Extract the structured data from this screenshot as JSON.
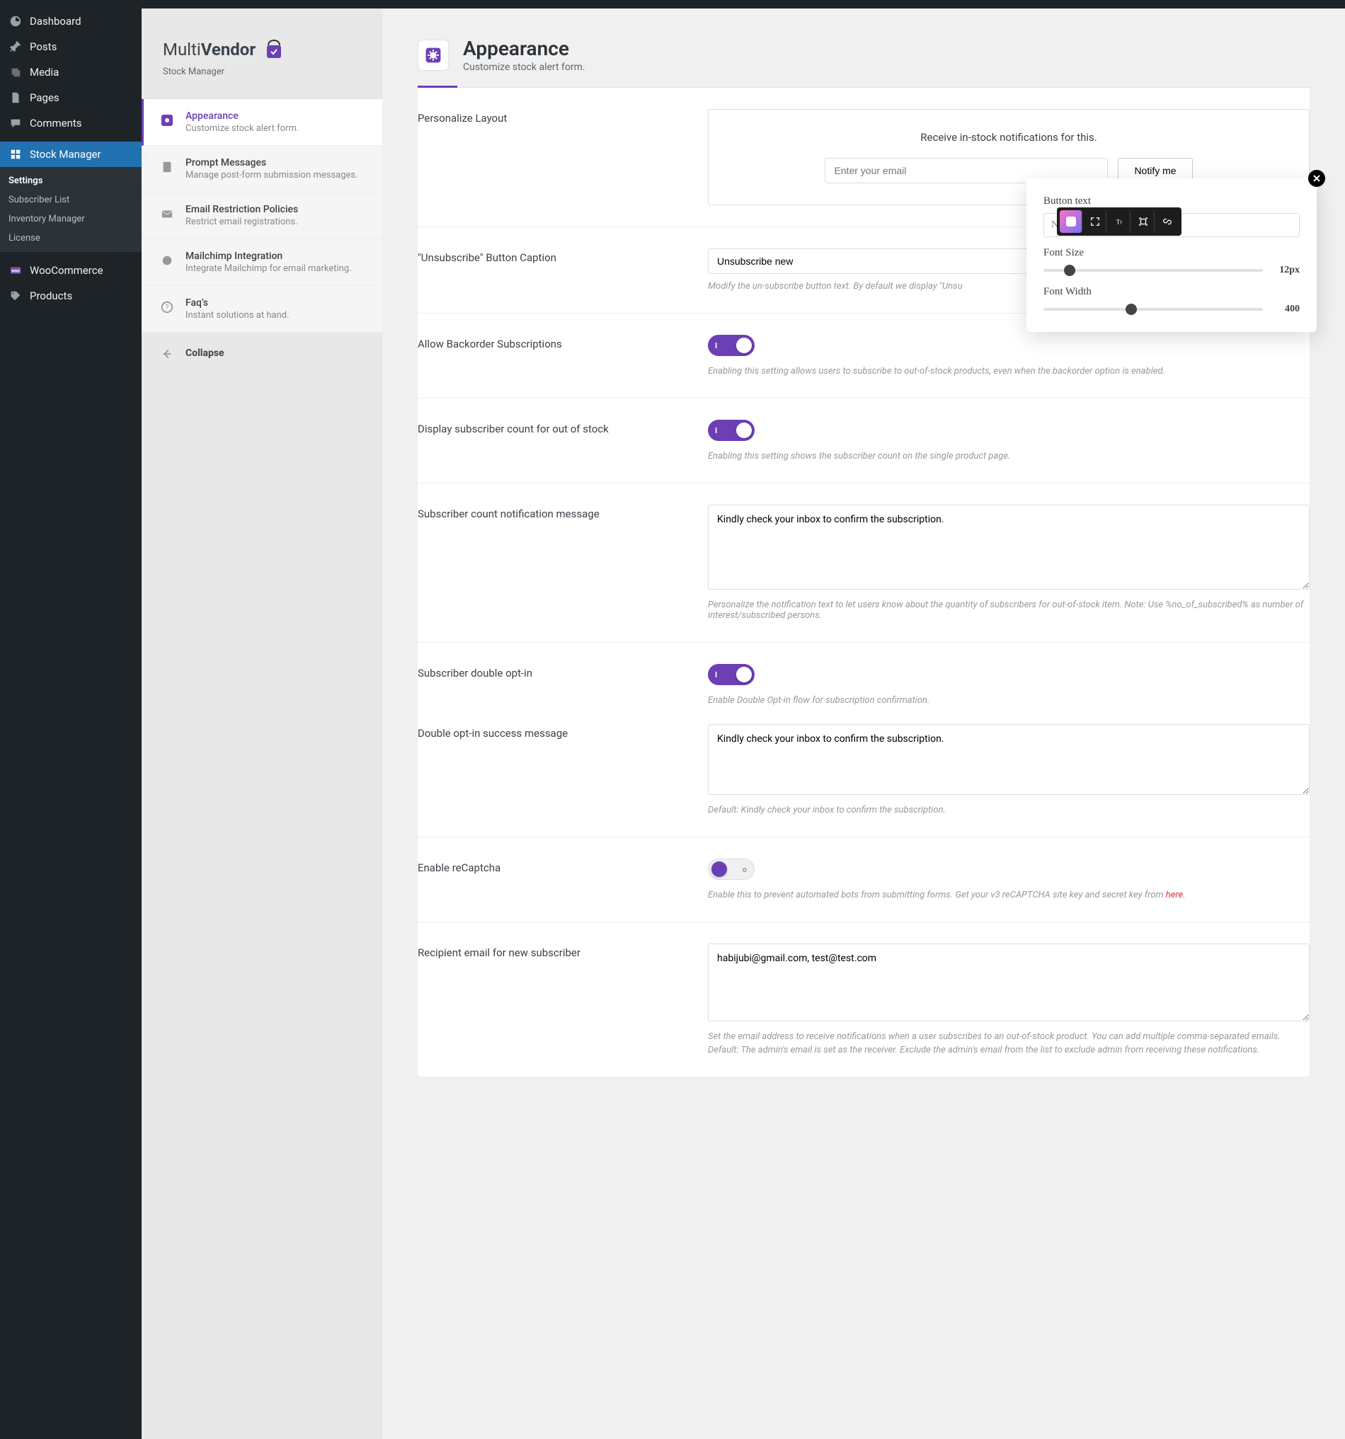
{
  "wp_menu": {
    "dashboard": "Dashboard",
    "posts": "Posts",
    "media": "Media",
    "pages": "Pages",
    "comments": "Comments",
    "stock_manager": "Stock Manager",
    "woocommerce": "WooCommerce",
    "products": "Products"
  },
  "wp_submenu": {
    "settings": "Settings",
    "subscriber_list": "Subscriber List",
    "inventory_manager": "Inventory Manager",
    "license": "License"
  },
  "plugin": {
    "brand_main": "Multi",
    "brand_bold": "Vendor",
    "brand_sub": "Stock Manager",
    "nav": {
      "appearance": {
        "title": "Appearance",
        "desc": "Customize stock alert form."
      },
      "prompt": {
        "title": "Prompt Messages",
        "desc": "Manage post-form submission messages."
      },
      "email": {
        "title": "Email Restriction Policies",
        "desc": "Restrict email registrations."
      },
      "mailchimp": {
        "title": "Mailchimp Integration",
        "desc": "Integrate Mailchimp for email marketing."
      },
      "faqs": {
        "title": "Faq's",
        "desc": "Instant solutions at hand."
      },
      "collapse": "Collapse"
    }
  },
  "page": {
    "title": "Appearance",
    "subtitle": "Customize stock alert form."
  },
  "settings": {
    "personalize": {
      "label": "Personalize Layout",
      "preview_heading": "Receive in-stock notifications for this.",
      "email_placeholder": "Enter your email",
      "button_text": "Notify me"
    },
    "unsubscribe": {
      "label": "\"Unsubscribe\" Button Caption",
      "value": "Unsubscribe new",
      "hint": "Modify the un-subscribe button text. By default we display \"Unsu"
    },
    "backorder": {
      "label": "Allow Backorder Subscriptions",
      "hint": "Enabling this setting allows users to subscribe to out-of-stock products, even when the backorder option is enabled."
    },
    "display_count": {
      "label": "Display subscriber count for out of stock",
      "hint": "Enabling this setting shows the subscriber count on the single product page."
    },
    "count_msg": {
      "label": "Subscriber count notification message",
      "value": "Kindly check your inbox to confirm the subscription.",
      "hint": "Personalize the notification text to let users know about the quantity of subscribers for out-of-stock item. Note: Use %no_of_subscribed% as number of interest/subscribed persons."
    },
    "double_optin": {
      "label": "Subscriber double opt-in",
      "hint": "Enable Double Opt-in flow for subscription confirmation."
    },
    "double_optin_msg": {
      "label": "Double opt-in success message",
      "value": "Kindly check your inbox to confirm the subscription.",
      "hint": "Default: Kindly check your inbox to confirm the subscription."
    },
    "recaptcha": {
      "label": "Enable reCaptcha",
      "hint_pre": "Enable this to prevent automated bots from submitting forms. Get your v3 reCAPTCHA site key and secret key from ",
      "hint_link": "here",
      "hint_post": "."
    },
    "recipient": {
      "label": "Recipient email for new subscriber",
      "value": "habijubi@gmail.com, test@test.com",
      "hint1": "Set the email address to receive notifications when a user subscribes to an out-of-stock product. You can add multiple comma-separated emails.",
      "hint2": "Default: The admin's email is set as the receiver. Exclude the admin's email from the list to exclude admin from receiving these notifications."
    }
  },
  "toggle": {
    "on": "I"
  },
  "popover": {
    "button_text_label": "Button text",
    "button_text_value": "Notify me",
    "font_size_label": "Font Size",
    "font_size_value": "12px",
    "font_width_label": "Font Width",
    "font_width_value": "400"
  }
}
